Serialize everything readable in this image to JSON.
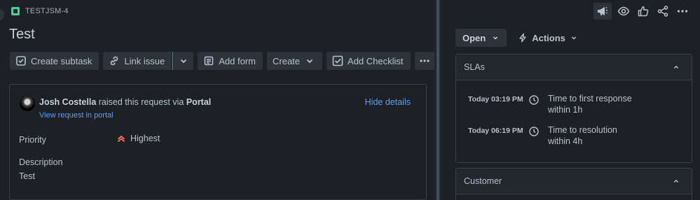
{
  "issue": {
    "key": "TESTJSM-4",
    "title": "Test"
  },
  "toolbar": {
    "create_subtask": "Create subtask",
    "link_issue": "Link issue",
    "add_form": "Add form",
    "create": "Create",
    "add_checklist": "Add Checklist"
  },
  "request": {
    "reporter": "Josh Costella",
    "raised_text": "raised this request via",
    "channel": "Portal",
    "view_link": "View request in portal",
    "hide_details": "Hide details"
  },
  "fields": {
    "priority_label": "Priority",
    "priority_value": "Highest",
    "description_label": "Description",
    "description_value": "Test"
  },
  "sidebar": {
    "status": "Open",
    "actions": "Actions",
    "slas": {
      "title": "SLAs",
      "items": [
        {
          "time": "Today 03:19 PM",
          "goal": "Time to first response",
          "within": "within 1h"
        },
        {
          "time": "Today 06:19 PM",
          "goal": "Time to resolution",
          "within": "within 4h"
        }
      ]
    },
    "customer": {
      "title": "Customer"
    }
  },
  "colors": {
    "background": "#1d2125",
    "link": "#579dff",
    "priority_highest": "#f87462",
    "issue_type": "#4bce97"
  },
  "icons": [
    "feedback-icon",
    "watch-icon",
    "like-icon",
    "share-icon",
    "more-icon"
  ]
}
